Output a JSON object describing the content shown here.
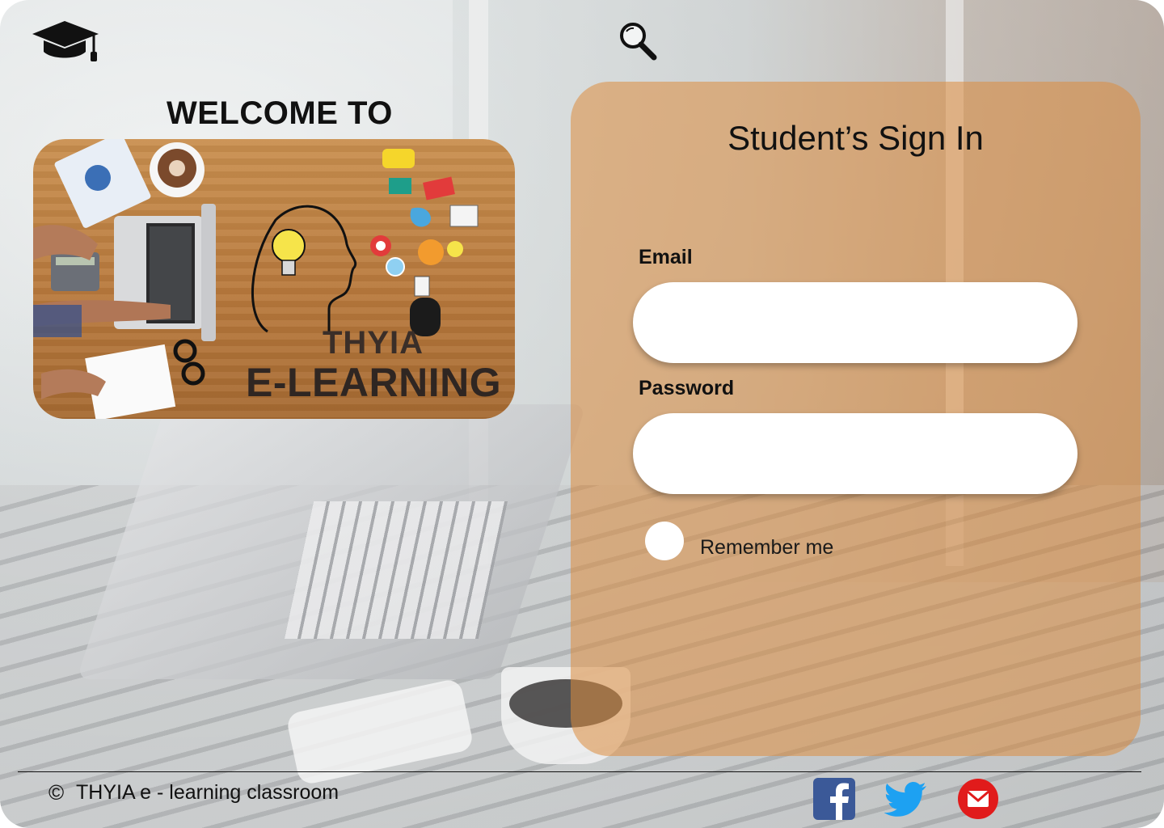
{
  "header": {
    "logo_icon": "graduation-cap-icon",
    "search_icon": "magnifier-icon"
  },
  "welcome": {
    "title": "WELCOME TO",
    "hero_line1": "THYIA",
    "hero_line2": "E-LEARNING"
  },
  "signin": {
    "title": "Student’s Sign In",
    "email_label": "Email",
    "email_value": "",
    "password_label": "Password",
    "password_value": "",
    "remember_label": "Remember me",
    "panel_color": "#dd8d3e"
  },
  "footer": {
    "copyright_symbol": "©",
    "copyright_text": "THYIA e - learning classroom",
    "social": [
      {
        "icon": "facebook-icon",
        "color": "#3b5998"
      },
      {
        "icon": "twitter-icon",
        "color": "#1da1f2"
      },
      {
        "icon": "mail-icon",
        "color": "#e11b1b"
      }
    ]
  }
}
